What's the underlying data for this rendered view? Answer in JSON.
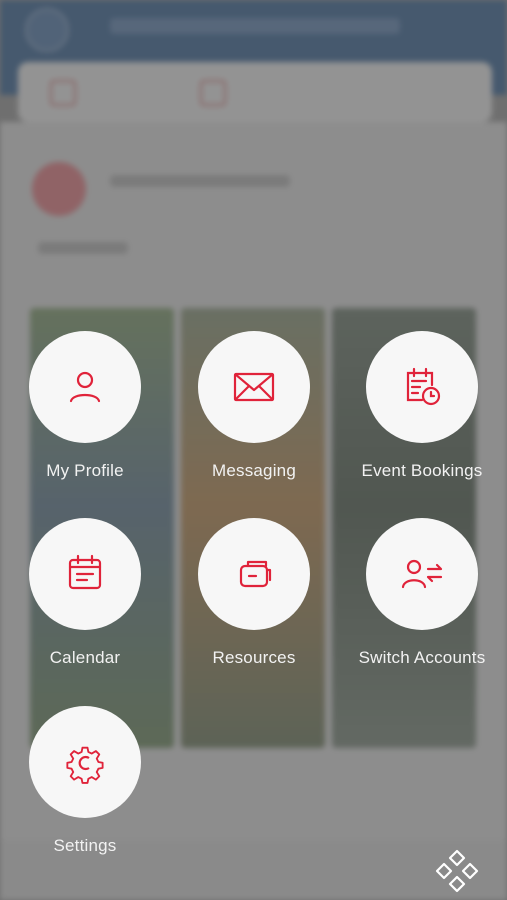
{
  "menu": {
    "items": [
      {
        "label": "My Profile",
        "icon": "user-icon"
      },
      {
        "label": "Messaging",
        "icon": "envelope-icon"
      },
      {
        "label": "Event Bookings",
        "icon": "calendar-clock-icon"
      },
      {
        "label": "Calendar",
        "icon": "calendar-icon"
      },
      {
        "label": "Resources",
        "icon": "resources-icon"
      },
      {
        "label": "Switch Accounts",
        "icon": "switch-accounts-icon"
      },
      {
        "label": "Settings",
        "icon": "gear-icon"
      }
    ],
    "icon_color": "#e0233a",
    "circle_color": "#f7f7f7",
    "label_color": "#f2f2f2"
  },
  "fab": {
    "icon": "menu-diamonds-icon"
  }
}
